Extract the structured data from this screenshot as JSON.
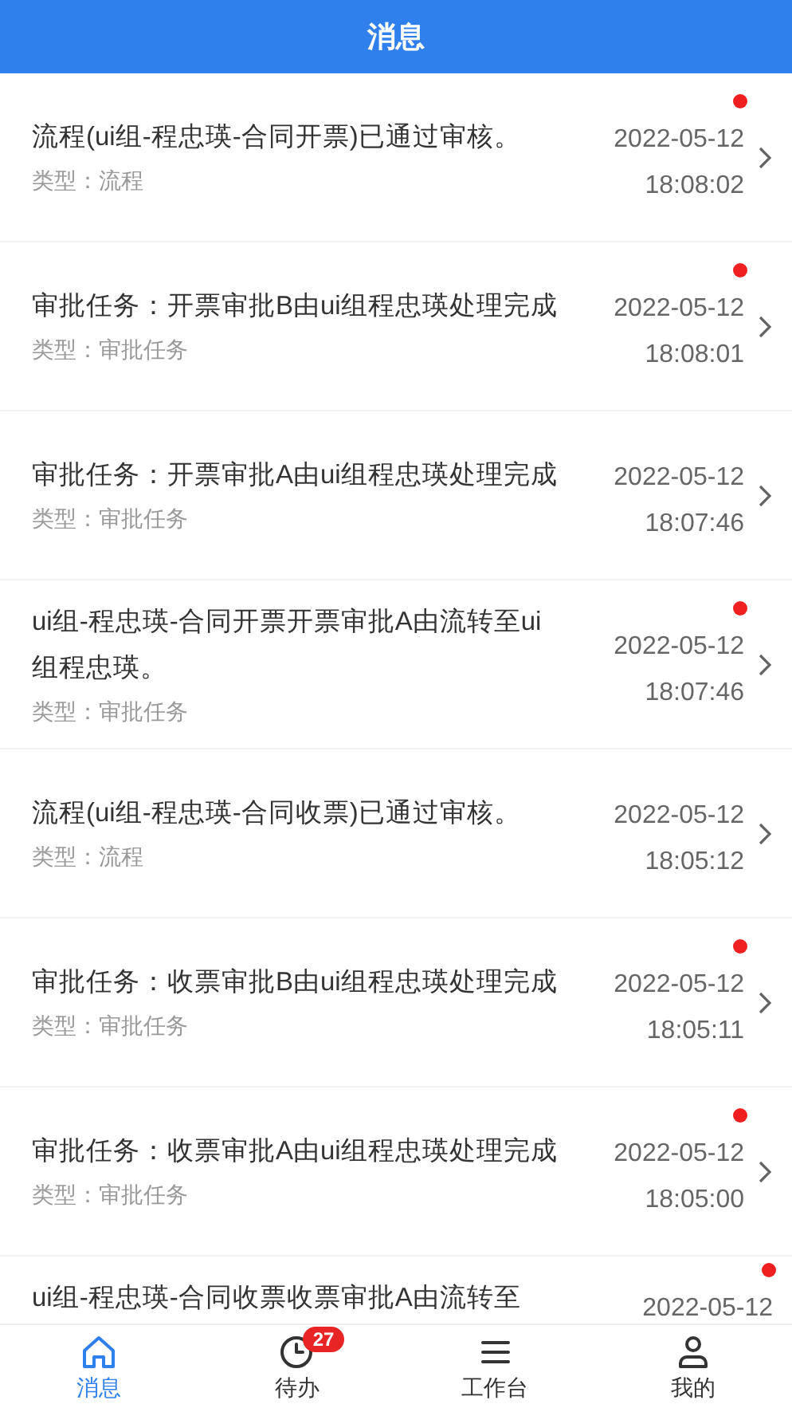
{
  "header": {
    "title": "消息"
  },
  "messages": [
    {
      "title": "流程(ui组-程忠瑛-合同开票)已通过审核。",
      "type": "类型：流程",
      "date": "2022-05-12",
      "time": "18:08:02",
      "unread": true
    },
    {
      "title": "审批任务：开票审批B由ui组程忠瑛处理完成",
      "type": "类型：审批任务",
      "date": "2022-05-12",
      "time": "18:08:01",
      "unread": true
    },
    {
      "title": "审批任务：开票审批A由ui组程忠瑛处理完成",
      "type": "类型：审批任务",
      "date": "2022-05-12",
      "time": "18:07:46",
      "unread": false
    },
    {
      "title": "ui组-程忠瑛-合同开票开票审批A由流转至ui组程忠瑛。",
      "type": "类型：审批任务",
      "date": "2022-05-12",
      "time": "18:07:46",
      "unread": true
    },
    {
      "title": "流程(ui组-程忠瑛-合同收票)已通过审核。",
      "type": "类型：流程",
      "date": "2022-05-12",
      "time": "18:05:12",
      "unread": false
    },
    {
      "title": "审批任务：收票审批B由ui组程忠瑛处理完成",
      "type": "类型：审批任务",
      "date": "2022-05-12",
      "time": "18:05:11",
      "unread": true
    },
    {
      "title": "审批任务：收票审批A由ui组程忠瑛处理完成",
      "type": "类型：审批任务",
      "date": "2022-05-12",
      "time": "18:05:00",
      "unread": true
    },
    {
      "title": "ui组-程忠瑛-合同收票收票审批A由流转至",
      "date": "2022-05-12",
      "unread": true
    }
  ],
  "tabbar": [
    {
      "kind": "home",
      "label": "消息",
      "selected": true
    },
    {
      "kind": "clock",
      "label": "待办",
      "selected": false,
      "badge": "27"
    },
    {
      "kind": "menu",
      "label": "工作台",
      "selected": false
    },
    {
      "kind": "user",
      "label": "我的",
      "selected": false
    }
  ]
}
